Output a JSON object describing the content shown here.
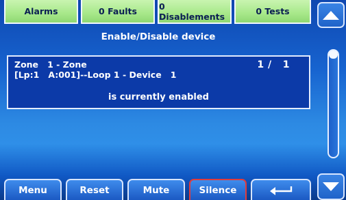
{
  "top_tabs": {
    "alarms": "Alarms",
    "faults": "0 Faults",
    "disablements": "0 Disablements",
    "tests": "0 Tests"
  },
  "screen_title": "Enable/Disable device",
  "device_info": {
    "zone_line": "Zone   1 - Zone",
    "device_line": "[Lp:1   A:001]--Loop 1 - Device   1",
    "page_counter": "1 /   1",
    "status": "is currently enabled"
  },
  "bottom_buttons": {
    "menu": "Menu",
    "reset": "Reset",
    "mute": "Mute",
    "silence": "Silence"
  },
  "icons": {
    "scroll_up": "triangle-up-icon",
    "scroll_down": "triangle-down-icon",
    "enter": "enter-return-icon"
  },
  "colors": {
    "tab_green": "#a7e88a",
    "panel_blue": "#0c3aa8",
    "silence_border": "#e23b3b"
  }
}
